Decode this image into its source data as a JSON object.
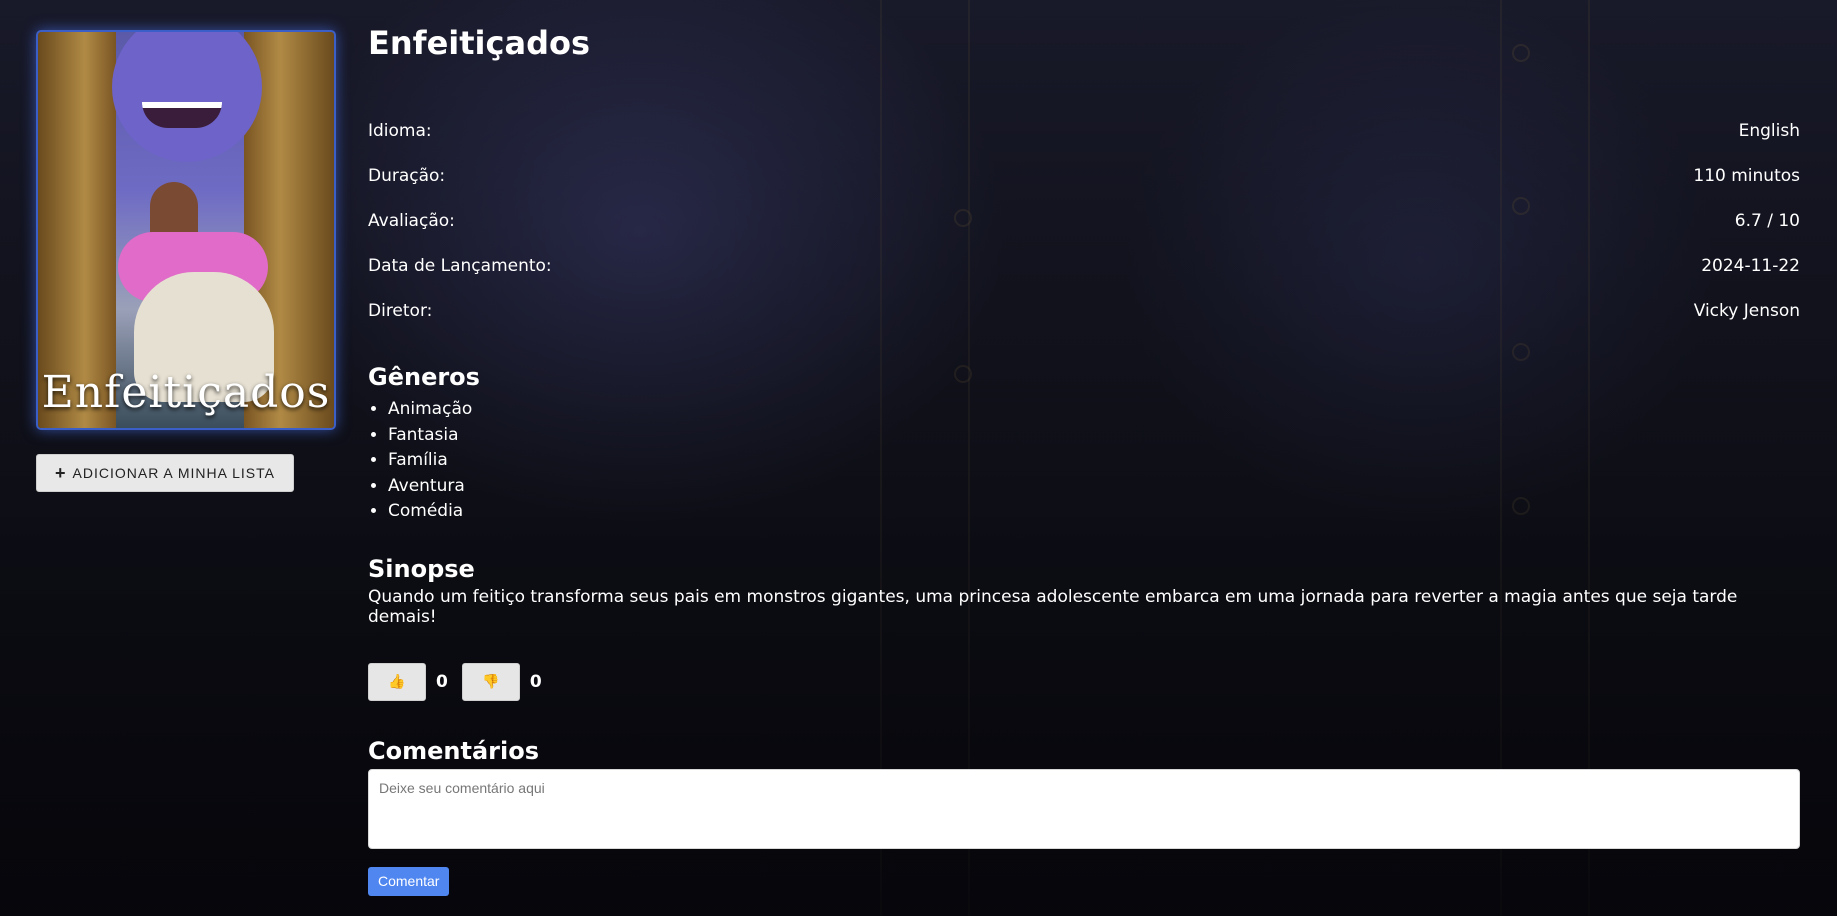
{
  "movie": {
    "title": "Enfeitiçados",
    "poster_title": "Enfeitiçados",
    "add_to_list_label": "ADICIONAR A MINHA LISTA"
  },
  "details": [
    {
      "label": "Idioma:",
      "value": "English"
    },
    {
      "label": "Duração:",
      "value": "110 minutos"
    },
    {
      "label": "Avaliação:",
      "value": "6.7 / 10"
    },
    {
      "label": "Data de Lançamento:",
      "value": "2024-11-22"
    },
    {
      "label": "Diretor:",
      "value": "Vicky Jenson"
    }
  ],
  "genres": {
    "heading": "Gêneros",
    "items": [
      "Animação",
      "Fantasia",
      "Família",
      "Aventura",
      "Comédia"
    ]
  },
  "synopsis": {
    "heading": "Sinopse",
    "text": "Quando um feitiço transforma seus pais em monstros gigantes, uma princesa adolescente embarca em uma jornada para reverter a magia antes que seja tarde demais!"
  },
  "votes": {
    "like_icon": "thumbs-up-icon",
    "like_count": "0",
    "dislike_icon": "thumbs-down-icon",
    "dislike_count": "0"
  },
  "comments": {
    "heading": "Comentários",
    "placeholder": "Deixe seu comentário aqui",
    "submit_label": "Comentar"
  },
  "colors": {
    "accent": "#4f86f0",
    "poster_glow": "#3c5fc7"
  }
}
